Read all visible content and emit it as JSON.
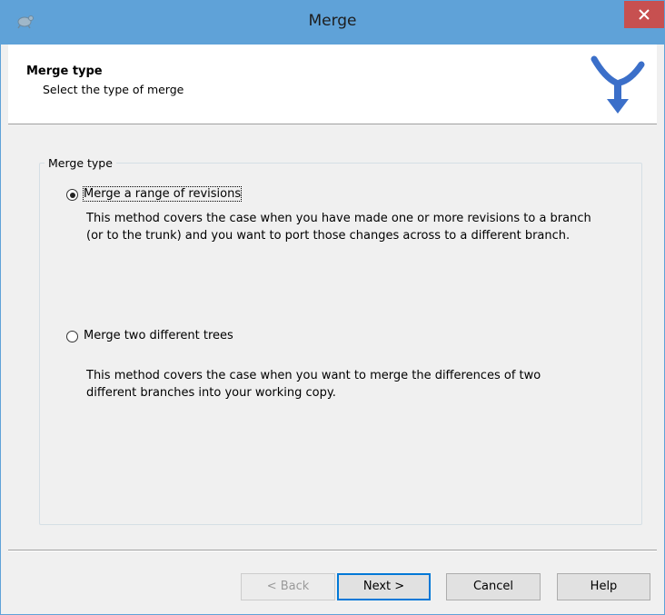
{
  "window": {
    "title": "Merge"
  },
  "header": {
    "title": "Merge type",
    "subtitle": "Select the type of merge"
  },
  "group": {
    "label": "Merge type"
  },
  "options": [
    {
      "label": "Merge a range of revisions",
      "selected": true,
      "description_lines": [
        "This method covers the case when you have made one or more revisions to a branch",
        "(or to the trunk) and you want to port those changes across to a different branch."
      ]
    },
    {
      "label": "Merge two different trees",
      "selected": false,
      "description_lines": [
        "This method covers the case when you want to merge the differences of two",
        "different branches into your working copy."
      ]
    }
  ],
  "buttons": {
    "back": "< Back",
    "next": "Next >",
    "cancel": "Cancel",
    "help": "Help"
  },
  "colors": {
    "titlebar": "#5fa2d8",
    "close": "#c75050",
    "merge_icon": "#3b6fc9"
  }
}
